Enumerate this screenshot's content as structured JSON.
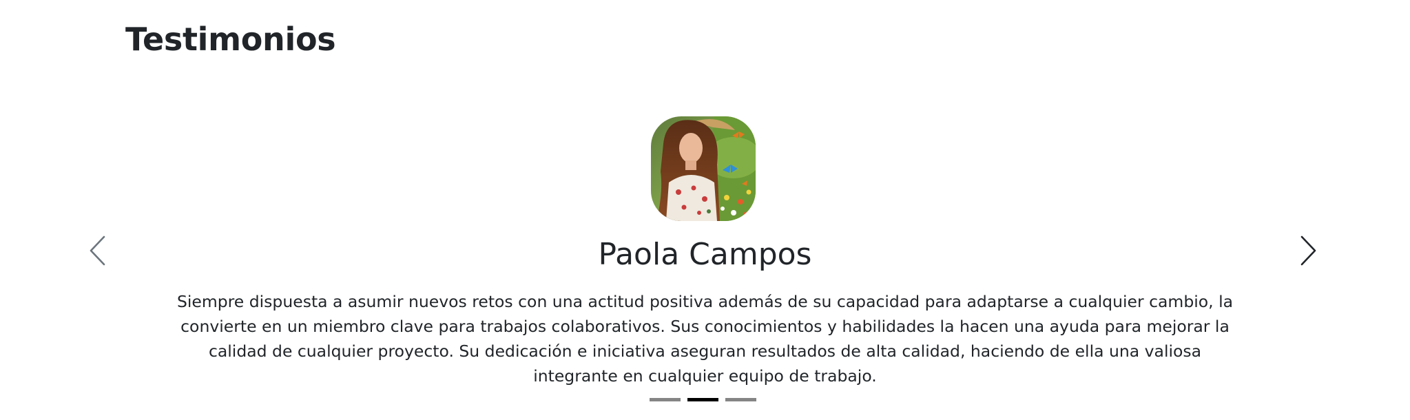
{
  "section": {
    "title": "Testimonios"
  },
  "testimonial": {
    "name": "Paola Campos",
    "text": "Siempre dispuesta a asumir nuevos retos con una actitud positiva además de su capacidad para adaptarse a cualquier cambio, la convierte en un miembro clave para trabajos colaborativos. Sus conocimientos y habilidades la hacen una ayuda para mejorar la calidad de cualquier proyecto. Su dedicación e iniciativa aseguran resultados de alta calidad, haciendo de ella una valiosa integrante en cualquier equipo de trabajo."
  },
  "carousel": {
    "prev_icon": "chevron-left-icon",
    "next_icon": "chevron-right-icon",
    "slide_count": 3,
    "active_index": 1
  },
  "colors": {
    "text": "#212529",
    "indicator_inactive": "#858585",
    "indicator_active": "#000000",
    "arrow_prev": "#6c757d",
    "arrow_next": "#212529"
  }
}
